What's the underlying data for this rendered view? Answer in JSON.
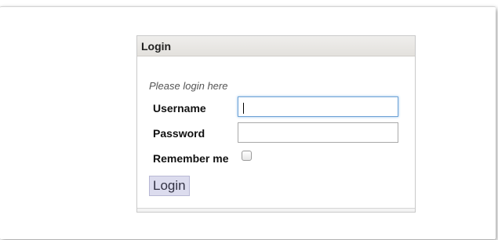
{
  "panel": {
    "title": "Login"
  },
  "form": {
    "hint": "Please login here",
    "username_label": "Username",
    "username_value": "",
    "password_label": "Password",
    "password_value": "",
    "remember_label": "Remember me",
    "remember_checked": false,
    "submit_label": "Login"
  },
  "colors": {
    "header_bg": "#e8e6e2",
    "button_bg": "#dcdcee",
    "focus_border": "#6fa3d6"
  }
}
